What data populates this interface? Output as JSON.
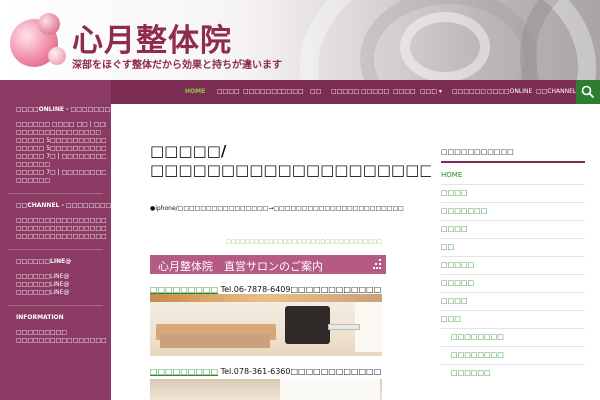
{
  "header": {
    "title": "心月整体院",
    "description": "深部をほぐす整体だから効果と持ちが違います"
  },
  "nav": {
    "items": [
      "HOME",
      "□□□□",
      "□□□□□□□",
      "□□□□",
      "□□",
      "□□□□□",
      "□□□□□",
      "□□□□",
      "□□□ ▾",
      "□□□□□□",
      "□□□□ONLINE",
      "□□CHANNEL"
    ],
    "active_index": 0,
    "search_icon": "search-icon"
  },
  "left_sidebar": {
    "widgets": [
      {
        "title": "□□□□ONLINE - □□□□□□□□□□",
        "lines": [
          "□□□□□□ □□□□ □□ | □□□□□□□□□□□□",
          "□□□□□□□□□□□□□□□",
          "□□□□□ 5□□□□□□□□□□□□□□□",
          "□□□□□ 5□□□□□□□□□□□□□□□",
          "□□□□□ 7□ | □□□□□□□□□□□□□□",
          "□□□□□□",
          "□□□□□ 7□ | □□□□□□□□□□□□□□□",
          "□□□□□□"
        ]
      },
      {
        "title": "□□CHANNEL - □□□□□□□□□□□□□",
        "lines": [
          "□□□□□□□□□□□□□□□□□□□□□□",
          "□□□□□□□□□□□□□□□□□□□□□□",
          "□□□□□□□□□□□□□□□□□□□□□□"
        ]
      },
      {
        "title": "□□□□□□LINE@",
        "lines": [
          "□□□□□□LINE@",
          "□□□□□□LINE@",
          "□□□□□□LINE@"
        ]
      },
      {
        "title": "INFORMATION",
        "lines": [
          "□□□□□□□□□",
          "□□□□□□□□□□□□□□□□□"
        ]
      }
    ]
  },
  "main": {
    "page_title": "□□□□□/□□□□□□□□□□□□□□□□□□□□□□□□□□□□□",
    "intro": "●iphone/□□□□□□□□□□□□□□□□→□□□□□□□□□□□□□□□□□□□□□□□",
    "note": "□□□□□□□□□□□□□□□□□□□□□□□□□□□□□□□□□",
    "banner_text": "心月整体院　直営サロンのご案内",
    "salons": [
      {
        "name": "□□□□□□□□□",
        "tel": "Tel.06-7878-6409",
        "rest": "□□□□□□□□□□□□"
      },
      {
        "name": "□□□□□□□□□",
        "tel": "Tel.078-361-6360",
        "rest": "□□□□□□□□□□□□"
      }
    ]
  },
  "right_sidebar": {
    "heading": "□□□□□□□□□□□",
    "items": [
      "HOME",
      "□□□□",
      "□□□□□□□",
      "□□□□",
      "□□",
      "□□□□□",
      "□□□□□",
      "□□□□",
      "□□□",
      "□□□□□□□□",
      "□□□□□□□□",
      "□□□□□□"
    ]
  },
  "colors": {
    "brand": "#8e2b4e",
    "nav_bg": "#7d2d54",
    "sidebar_bg": "#8a3a63",
    "link": "#2e8b2e",
    "nav_active": "#8fcb4a",
    "banner": "#b45a83"
  }
}
